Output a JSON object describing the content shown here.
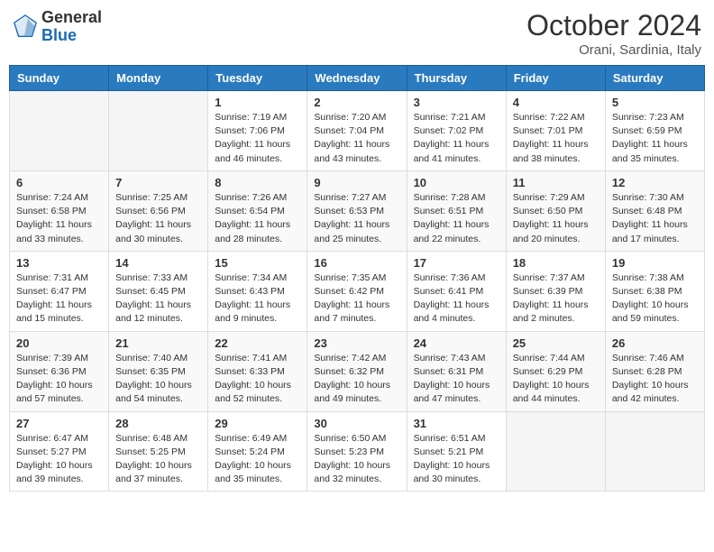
{
  "header": {
    "logo_general": "General",
    "logo_blue": "Blue",
    "month": "October 2024",
    "location": "Orani, Sardinia, Italy"
  },
  "weekdays": [
    "Sunday",
    "Monday",
    "Tuesday",
    "Wednesday",
    "Thursday",
    "Friday",
    "Saturday"
  ],
  "weeks": [
    [
      {
        "day": "",
        "content": ""
      },
      {
        "day": "",
        "content": ""
      },
      {
        "day": "1",
        "content": "Sunrise: 7:19 AM\nSunset: 7:06 PM\nDaylight: 11 hours and 46 minutes."
      },
      {
        "day": "2",
        "content": "Sunrise: 7:20 AM\nSunset: 7:04 PM\nDaylight: 11 hours and 43 minutes."
      },
      {
        "day": "3",
        "content": "Sunrise: 7:21 AM\nSunset: 7:02 PM\nDaylight: 11 hours and 41 minutes."
      },
      {
        "day": "4",
        "content": "Sunrise: 7:22 AM\nSunset: 7:01 PM\nDaylight: 11 hours and 38 minutes."
      },
      {
        "day": "5",
        "content": "Sunrise: 7:23 AM\nSunset: 6:59 PM\nDaylight: 11 hours and 35 minutes."
      }
    ],
    [
      {
        "day": "6",
        "content": "Sunrise: 7:24 AM\nSunset: 6:58 PM\nDaylight: 11 hours and 33 minutes."
      },
      {
        "day": "7",
        "content": "Sunrise: 7:25 AM\nSunset: 6:56 PM\nDaylight: 11 hours and 30 minutes."
      },
      {
        "day": "8",
        "content": "Sunrise: 7:26 AM\nSunset: 6:54 PM\nDaylight: 11 hours and 28 minutes."
      },
      {
        "day": "9",
        "content": "Sunrise: 7:27 AM\nSunset: 6:53 PM\nDaylight: 11 hours and 25 minutes."
      },
      {
        "day": "10",
        "content": "Sunrise: 7:28 AM\nSunset: 6:51 PM\nDaylight: 11 hours and 22 minutes."
      },
      {
        "day": "11",
        "content": "Sunrise: 7:29 AM\nSunset: 6:50 PM\nDaylight: 11 hours and 20 minutes."
      },
      {
        "day": "12",
        "content": "Sunrise: 7:30 AM\nSunset: 6:48 PM\nDaylight: 11 hours and 17 minutes."
      }
    ],
    [
      {
        "day": "13",
        "content": "Sunrise: 7:31 AM\nSunset: 6:47 PM\nDaylight: 11 hours and 15 minutes."
      },
      {
        "day": "14",
        "content": "Sunrise: 7:33 AM\nSunset: 6:45 PM\nDaylight: 11 hours and 12 minutes."
      },
      {
        "day": "15",
        "content": "Sunrise: 7:34 AM\nSunset: 6:43 PM\nDaylight: 11 hours and 9 minutes."
      },
      {
        "day": "16",
        "content": "Sunrise: 7:35 AM\nSunset: 6:42 PM\nDaylight: 11 hours and 7 minutes."
      },
      {
        "day": "17",
        "content": "Sunrise: 7:36 AM\nSunset: 6:41 PM\nDaylight: 11 hours and 4 minutes."
      },
      {
        "day": "18",
        "content": "Sunrise: 7:37 AM\nSunset: 6:39 PM\nDaylight: 11 hours and 2 minutes."
      },
      {
        "day": "19",
        "content": "Sunrise: 7:38 AM\nSunset: 6:38 PM\nDaylight: 10 hours and 59 minutes."
      }
    ],
    [
      {
        "day": "20",
        "content": "Sunrise: 7:39 AM\nSunset: 6:36 PM\nDaylight: 10 hours and 57 minutes."
      },
      {
        "day": "21",
        "content": "Sunrise: 7:40 AM\nSunset: 6:35 PM\nDaylight: 10 hours and 54 minutes."
      },
      {
        "day": "22",
        "content": "Sunrise: 7:41 AM\nSunset: 6:33 PM\nDaylight: 10 hours and 52 minutes."
      },
      {
        "day": "23",
        "content": "Sunrise: 7:42 AM\nSunset: 6:32 PM\nDaylight: 10 hours and 49 minutes."
      },
      {
        "day": "24",
        "content": "Sunrise: 7:43 AM\nSunset: 6:31 PM\nDaylight: 10 hours and 47 minutes."
      },
      {
        "day": "25",
        "content": "Sunrise: 7:44 AM\nSunset: 6:29 PM\nDaylight: 10 hours and 44 minutes."
      },
      {
        "day": "26",
        "content": "Sunrise: 7:46 AM\nSunset: 6:28 PM\nDaylight: 10 hours and 42 minutes."
      }
    ],
    [
      {
        "day": "27",
        "content": "Sunrise: 6:47 AM\nSunset: 5:27 PM\nDaylight: 10 hours and 39 minutes."
      },
      {
        "day": "28",
        "content": "Sunrise: 6:48 AM\nSunset: 5:25 PM\nDaylight: 10 hours and 37 minutes."
      },
      {
        "day": "29",
        "content": "Sunrise: 6:49 AM\nSunset: 5:24 PM\nDaylight: 10 hours and 35 minutes."
      },
      {
        "day": "30",
        "content": "Sunrise: 6:50 AM\nSunset: 5:23 PM\nDaylight: 10 hours and 32 minutes."
      },
      {
        "day": "31",
        "content": "Sunrise: 6:51 AM\nSunset: 5:21 PM\nDaylight: 10 hours and 30 minutes."
      },
      {
        "day": "",
        "content": ""
      },
      {
        "day": "",
        "content": ""
      }
    ]
  ]
}
